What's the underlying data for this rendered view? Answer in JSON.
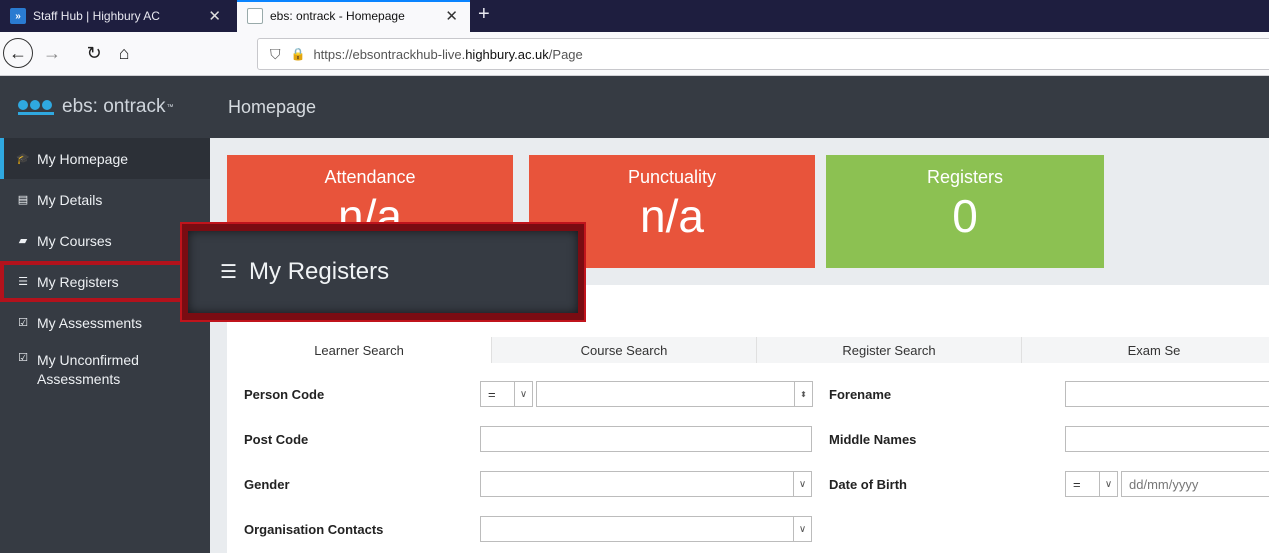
{
  "browser": {
    "tabs": [
      {
        "title": "Staff Hub | Highbury AC",
        "close": "✕"
      },
      {
        "title": "ebs: ontrack - Homepage",
        "close": "✕"
      }
    ],
    "new_tab": "+",
    "url_prefix": "https://ebsontrackhub-live.",
    "url_host": "highbury.ac.uk",
    "url_path": "/Page"
  },
  "app": {
    "brand": "ebs: ontrack",
    "brand_mark": "™",
    "page_title": "Homepage"
  },
  "sidebar": {
    "items": [
      {
        "label": "My Homepage",
        "icon": "graduation-cap-icon"
      },
      {
        "label": "My Details",
        "icon": "id-card-icon"
      },
      {
        "label": "My Courses",
        "icon": "book-icon"
      },
      {
        "label": "My Registers",
        "icon": "list-icon"
      },
      {
        "label": "My Assessments",
        "icon": "checklist-icon"
      },
      {
        "label": "My Unconfirmed Assessments",
        "icon": "checklist-icon"
      }
    ]
  },
  "tiles": {
    "attendance": {
      "label": "Attendance",
      "value": "n/a"
    },
    "punctuality": {
      "label": "Punctuality",
      "value": "n/a"
    },
    "registers": {
      "label": "Registers",
      "value": "0"
    }
  },
  "search": {
    "tabs": [
      "Learner Search",
      "Course Search",
      "Register Search",
      "Exam Se"
    ],
    "fields": {
      "person_code": "Person Code",
      "person_code_op": "=",
      "post_code": "Post Code",
      "gender": "Gender",
      "org_contacts": "Organisation Contacts",
      "forename": "Forename",
      "middle_names": "Middle Names",
      "dob": "Date of Birth",
      "dob_op": "=",
      "dob_placeholder": "dd/mm/yyyy"
    }
  },
  "callout": {
    "label": "My Registers"
  },
  "colors": {
    "sidebar_bg": "#363b43",
    "accent": "#2fa8e0",
    "tile_red": "#e8543b",
    "tile_green": "#8cc152",
    "highlight_red": "#b3121c"
  }
}
